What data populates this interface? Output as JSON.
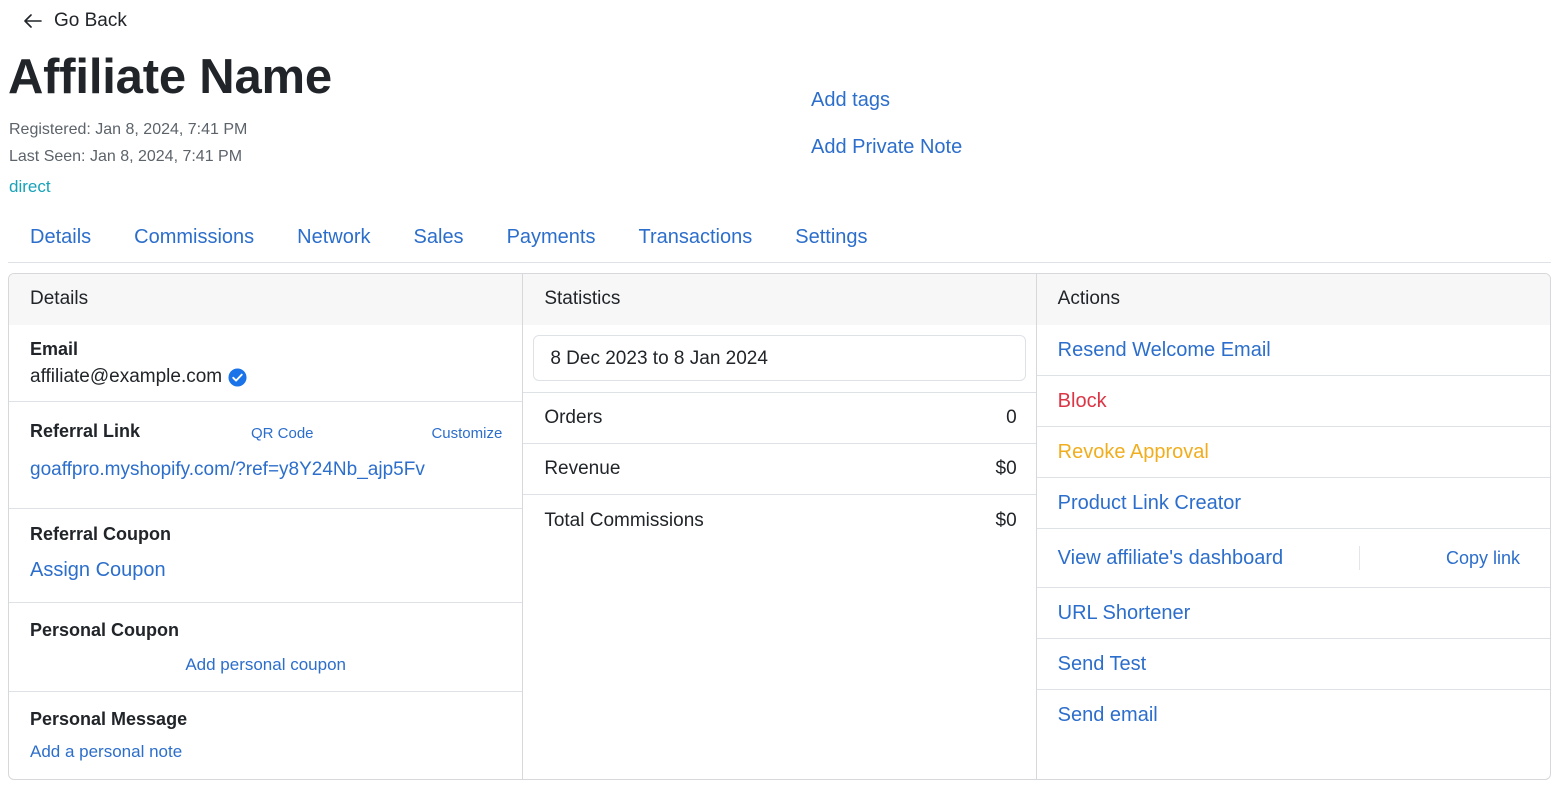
{
  "header": {
    "back_label": "Go Back",
    "title": "Affiliate Name",
    "registered": "Registered: Jan 8, 2024, 7:41 PM",
    "last_seen": "Last Seen: Jan 8, 2024, 7:41 PM",
    "source": "direct",
    "add_tags": "Add tags",
    "add_private_note": "Add Private Note"
  },
  "tabs": [
    "Details",
    "Commissions",
    "Network",
    "Sales",
    "Payments",
    "Transactions",
    "Settings"
  ],
  "details": {
    "heading": "Details",
    "email_label": "Email",
    "email_value": "affiliate@example.com",
    "referral_link_label": "Referral Link",
    "qr_code": "QR Code",
    "customize": "Customize",
    "referral_link": "goaffpro.myshopify.com/?ref=y8Y24Nb_ajp5Fv",
    "referral_coupon_label": "Referral Coupon",
    "assign_coupon": "Assign Coupon",
    "personal_coupon_label": "Personal Coupon",
    "add_personal_coupon": "Add personal coupon",
    "personal_message_label": "Personal Message",
    "add_personal_note": "Add a personal note"
  },
  "statistics": {
    "heading": "Statistics",
    "date_range": "8 Dec 2023 to 8 Jan 2024",
    "rows": [
      {
        "label": "Orders",
        "value": "0"
      },
      {
        "label": "Revenue",
        "value": "$0"
      },
      {
        "label": "Total Commissions",
        "value": "$0"
      }
    ]
  },
  "actions": {
    "heading": "Actions",
    "resend_welcome": "Resend Welcome Email",
    "block": "Block",
    "revoke_approval": "Revoke Approval",
    "product_link_creator": "Product Link Creator",
    "view_dashboard": "View affiliate's dashboard",
    "copy_link": "Copy link",
    "url_shortener": "URL Shortener",
    "send_test": "Send Test",
    "send_email": "Send email"
  },
  "colors": {
    "link": "#2c6ecb",
    "danger": "#dc3545",
    "warning": "#f0ad1e",
    "source": "#17a2b8",
    "verified": "#1a73e8"
  }
}
